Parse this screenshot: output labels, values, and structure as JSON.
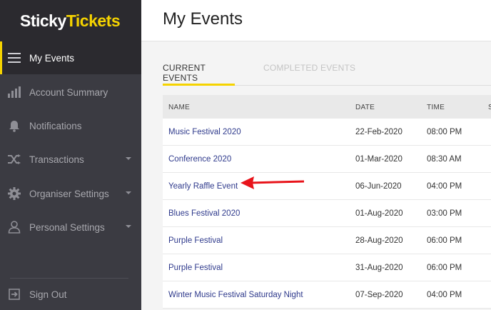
{
  "logo": {
    "part1": "Sticky",
    "part2": "Tickets"
  },
  "sidebar": {
    "items": [
      {
        "label": "My Events",
        "icon": "hamburger-icon"
      },
      {
        "label": "Account Summary",
        "icon": "bar-chart-icon"
      },
      {
        "label": "Notifications",
        "icon": "bell-icon"
      },
      {
        "label": "Transactions",
        "icon": "shuffle-icon"
      },
      {
        "label": "Organiser Settings",
        "icon": "gear-icon"
      },
      {
        "label": "Personal Settings",
        "icon": "person-icon"
      },
      {
        "label": "Sign Out",
        "icon": "sign-out-icon"
      }
    ]
  },
  "header": {
    "title": "My Events"
  },
  "tabs": [
    {
      "label": "CURRENT EVENTS"
    },
    {
      "label": "COMPLETED EVENTS"
    }
  ],
  "table": {
    "headers": {
      "name": "NAME",
      "date": "DATE",
      "time": "TIME",
      "more": "S"
    },
    "rows": [
      {
        "name": "Music Festival 2020",
        "date": "22-Feb-2020",
        "time": "08:00 PM"
      },
      {
        "name": "Conference 2020",
        "date": "01-Mar-2020",
        "time": "08:30 AM"
      },
      {
        "name": "Yearly Raffle Event",
        "date": "06-Jun-2020",
        "time": "04:00 PM"
      },
      {
        "name": "Blues Festival 2020",
        "date": "01-Aug-2020",
        "time": "03:00 PM"
      },
      {
        "name": "Purple Festival",
        "date": "28-Aug-2020",
        "time": "06:00 PM"
      },
      {
        "name": "Purple Festival",
        "date": "31-Aug-2020",
        "time": "06:00 PM"
      },
      {
        "name": "Winter Music Festival Saturday Night",
        "date": "07-Sep-2020",
        "time": "04:00 PM"
      }
    ]
  },
  "colors": {
    "accent": "#f5d300",
    "link": "#2f3a8c",
    "arrow": "#e8141b",
    "sidebar": "#3b3b42"
  }
}
